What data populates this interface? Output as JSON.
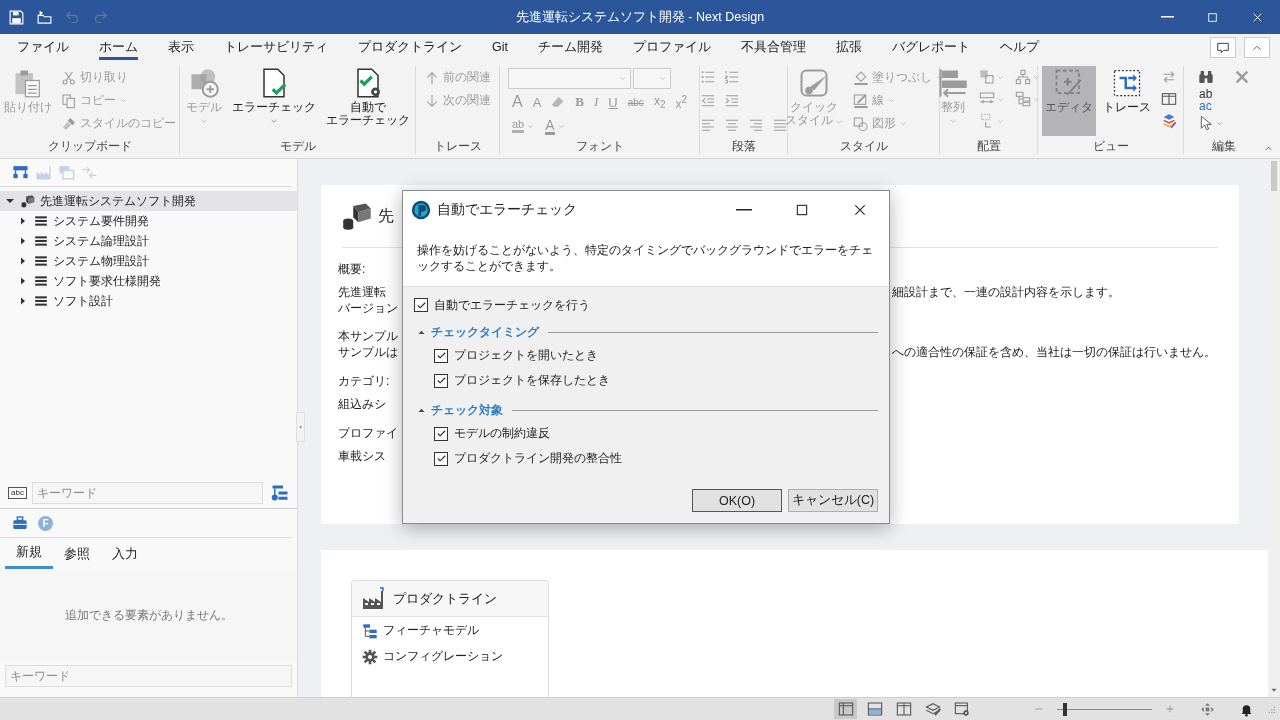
{
  "titlebar": {
    "title": "先進運転システムソフト開発 - Next Design",
    "quick_access": [
      {
        "disabled": false
      },
      {
        "disabled": false
      },
      {
        "disabled": true
      },
      {
        "disabled": true
      }
    ]
  },
  "menu_tabs": [
    {
      "label": "ファイル",
      "selected": false
    },
    {
      "label": "ホーム",
      "selected": true
    },
    {
      "label": "表示",
      "selected": false
    },
    {
      "label": "トレーサビリティ",
      "selected": false
    },
    {
      "label": "プロダクトライン",
      "selected": false
    },
    {
      "label": "Git",
      "selected": false
    },
    {
      "label": "チーム開発",
      "selected": false
    },
    {
      "label": "プロファイル",
      "selected": false
    },
    {
      "label": "不具合管理",
      "selected": false
    },
    {
      "label": "拡張",
      "selected": false
    },
    {
      "label": "バグレポート",
      "selected": false
    },
    {
      "label": "ヘルプ",
      "selected": false
    }
  ],
  "ribbon": {
    "groups": [
      {
        "label": "クリップボード",
        "kind": "columns",
        "lines": [
          [
            {
              "kind": "large",
              "label": "貼り付け",
              "disabled": true
            }
          ],
          [
            {
              "kind": "small",
              "label": "切り取り",
              "disabled": true
            },
            {
              "kind": "small",
              "label": "コピー",
              "disabled": true,
              "dropdown": true
            },
            {
              "kind": "small",
              "label": "スタイルのコピー",
              "disabled": true
            }
          ]
        ]
      },
      {
        "label": "モデル",
        "kind": "columns",
        "lines": [
          [
            {
              "kind": "large",
              "label": "モデル",
              "disabled": true,
              "dropdown": true
            }
          ],
          [
            {
              "kind": "large",
              "label": "エラーチェック",
              "disabled": false,
              "dropdown": true
            }
          ],
          [
            {
              "kind": "large",
              "label_lines": [
                "自動で",
                "エラーチェック"
              ],
              "disabled": false
            }
          ]
        ]
      },
      {
        "label": "トレース",
        "kind": "columns",
        "lines": [
          [
            {
              "kind": "small",
              "label": "前の関連",
              "disabled": true
            },
            {
              "kind": "small",
              "label": "次の関連",
              "disabled": true
            }
          ]
        ]
      },
      {
        "label": "フォント",
        "kind": "rows",
        "lines": [
          [
            {
              "kind": "combo",
              "disabled": true
            },
            {
              "kind": "combo",
              "disabled": true
            }
          ],
          [
            {
              "kind": "glyph",
              "label": "A",
              "disabled": true
            },
            {
              "kind": "glyph",
              "label": "A",
              "disabled": true
            },
            {
              "kind": "icon",
              "disabled": true
            },
            {
              "kind": "glyph",
              "label": "B",
              "disabled": true
            },
            {
              "kind": "glyph",
              "label": "I",
              "disabled": true
            },
            {
              "kind": "glyph",
              "label": "U",
              "disabled": true
            },
            {
              "kind": "glyph",
              "label": "abc",
              "disabled": true
            },
            {
              "kind": "glyph",
              "label": "x$_{2}$",
              "disabled": true
            },
            {
              "kind": "glyph",
              "label": "x$^{2}$",
              "disabled": true
            }
          ],
          [
            {
              "kind": "glyph",
              "label": "ab",
              "disabled": true,
              "dropdown": true
            },
            {
              "kind": "glyph",
              "label": "A",
              "disabled": true,
              "dropdown": true
            }
          ]
        ]
      },
      {
        "label": "段落",
        "kind": "rows",
        "lines": [
          [
            {
              "kind": "icon",
              "disabled": true
            },
            {
              "kind": "icon",
              "disabled": true
            }
          ],
          [
            {
              "kind": "icon",
              "disabled": true
            },
            {
              "kind": "icon",
              "disabled": true
            }
          ],
          [
            {
              "kind": "icon",
              "disabled": true
            },
            {
              "kind": "icon",
              "disabled": true
            },
            {
              "kind": "icon",
              "disabled": true
            },
            {
              "kind": "icon",
              "disabled": true
            }
          ]
        ]
      },
      {
        "label": "スタイル",
        "kind": "columns",
        "lines": [
          [
            {
              "kind": "large",
              "label_lines": [
                "クイック",
                "スタイル"
              ],
              "disabled": true,
              "dropdown": true
            }
          ],
          [
            {
              "kind": "small",
              "label": "塗りつぶし",
              "disabled": true,
              "dropdown": true
            },
            {
              "kind": "small",
              "label": "線",
              "disabled": true,
              "dropdown": true
            },
            {
              "kind": "small",
              "label": "図形",
              "disabled": true,
              "dropdown": true
            }
          ]
        ]
      },
      {
        "label": "配置",
        "kind": "columns",
        "lines": [
          [
            {
              "kind": "large",
              "label": "整列",
              "disabled": true,
              "dropdown": true
            }
          ],
          [
            {
              "kind": "icon",
              "disabled": true,
              "dropdown": true
            },
            {
              "kind": "icon",
              "disabled": true,
              "dropdown": true
            },
            {
              "kind": "icon",
              "disabled": true,
              "dropdown": true
            }
          ],
          [
            {
              "kind": "icon",
              "disabled": true,
              "dropdown": true
            },
            {
              "kind": "icon",
              "disabled": true,
              "dropdown": true
            }
          ]
        ]
      },
      {
        "label": "ビュー",
        "kind": "columns",
        "lines": [
          [
            {
              "kind": "large",
              "label": "エディタ",
              "disabled": true,
              "selected": true
            }
          ],
          [
            {
              "kind": "large",
              "label": "トレース",
              "disabled": false,
              "selected": false
            }
          ],
          [
            {
              "kind": "icon",
              "disabled": true
            },
            {
              "kind": "icon",
              "disabled": false
            },
            {
              "kind": "icon",
              "disabled": false
            }
          ]
        ]
      },
      {
        "label": "編集",
        "kind": "columns",
        "lines": [
          [
            {
              "kind": "icon",
              "disabled": false
            },
            {
              "kind": "glyph",
              "label": "ab",
              "label2": "ac",
              "disabled": false
            },
            {
              "kind": "icon",
              "disabled": false,
              "dropdown": true
            }
          ],
          [
            {
              "kind": "icon",
              "disabled": true
            }
          ]
        ]
      }
    ]
  },
  "explorer": {
    "toolbar": [
      {
        "disabled": false
      },
      {
        "disabled": true
      },
      {
        "disabled": true
      },
      {
        "disabled": true
      }
    ],
    "tree": [
      {
        "label": "先進運転システムソフト開発",
        "expanded": true,
        "selected": true,
        "children": [
          {
            "label": "システム要件開発",
            "expanded": false,
            "selected": false
          },
          {
            "label": "システム論理設計",
            "expanded": false,
            "selected": false
          },
          {
            "label": "システム物理設計",
            "expanded": false,
            "selected": false
          },
          {
            "label": "ソフト要求仕様開発",
            "expanded": false,
            "selected": false
          },
          {
            "label": "ソフト設計",
            "expanded": false,
            "selected": false
          }
        ]
      }
    ],
    "search": {
      "mode_label": "abc",
      "placeholder": "キーワード"
    }
  },
  "toolbox": {
    "badge": "F",
    "tabs": [
      {
        "label": "新規",
        "selected": true
      },
      {
        "label": "参照",
        "selected": false
      },
      {
        "label": "入力",
        "selected": false
      }
    ],
    "empty_message": "追加できる要素がありません。",
    "search": {
      "placeholder": "キーワード"
    }
  },
  "document": {
    "title": "先",
    "sections": [
      {
        "heading": "概要:",
        "paragraphs": [
          [
            {
              "left": "先進運転",
              "right": "細設計まで、一連の設計内容を示します。"
            },
            {
              "left": "バージョン"
            }
          ],
          [
            {
              "left": "本サンプル"
            },
            {
              "left": "サンプルは",
              "right": "への適合性の保証を含め、当社は一切の保証は行いません。"
            }
          ]
        ]
      },
      {
        "heading": "カテゴリ:",
        "paragraphs": [
          [
            {
              "left": "組込みシ"
            }
          ]
        ]
      },
      {
        "heading": "プロファイ",
        "paragraphs": [
          [
            {
              "left": "車載シス"
            }
          ]
        ]
      }
    ]
  },
  "product_line": {
    "title": "プロダクトライン",
    "items": [
      {
        "label": "フィーチャモデル"
      },
      {
        "label": "コンフィグレーション"
      }
    ]
  },
  "dialog": {
    "title": "自動でエラーチェック",
    "description": "操作を妨げることがないよう、特定のタイミングでバックグラウンドでエラーをチェックすることができます。",
    "main_option": {
      "label": "自動でエラーチェックを行う",
      "checked": true
    },
    "sections": [
      {
        "title": "チェックタイミング",
        "expanded": true,
        "options": [
          {
            "label": "プロジェクトを開いたとき",
            "checked": true
          },
          {
            "label": "プロジェクトを保存したとき",
            "checked": true
          }
        ]
      },
      {
        "title": "チェック対象",
        "expanded": true,
        "options": [
          {
            "label": "モデルの制約違反",
            "checked": true
          },
          {
            "label": "プロダクトライン開発の整合性",
            "checked": true
          }
        ]
      }
    ],
    "buttons": [
      {
        "label": "OK(O)",
        "default": true
      },
      {
        "label": "キャンセル(C)",
        "default": false
      }
    ]
  },
  "status_bar": {
    "views": [
      {
        "selected": true
      },
      {
        "selected": false
      },
      {
        "selected": false
      },
      {
        "selected": false
      },
      {
        "selected": false
      }
    ],
    "zoom": {
      "level": 0.06
    }
  }
}
